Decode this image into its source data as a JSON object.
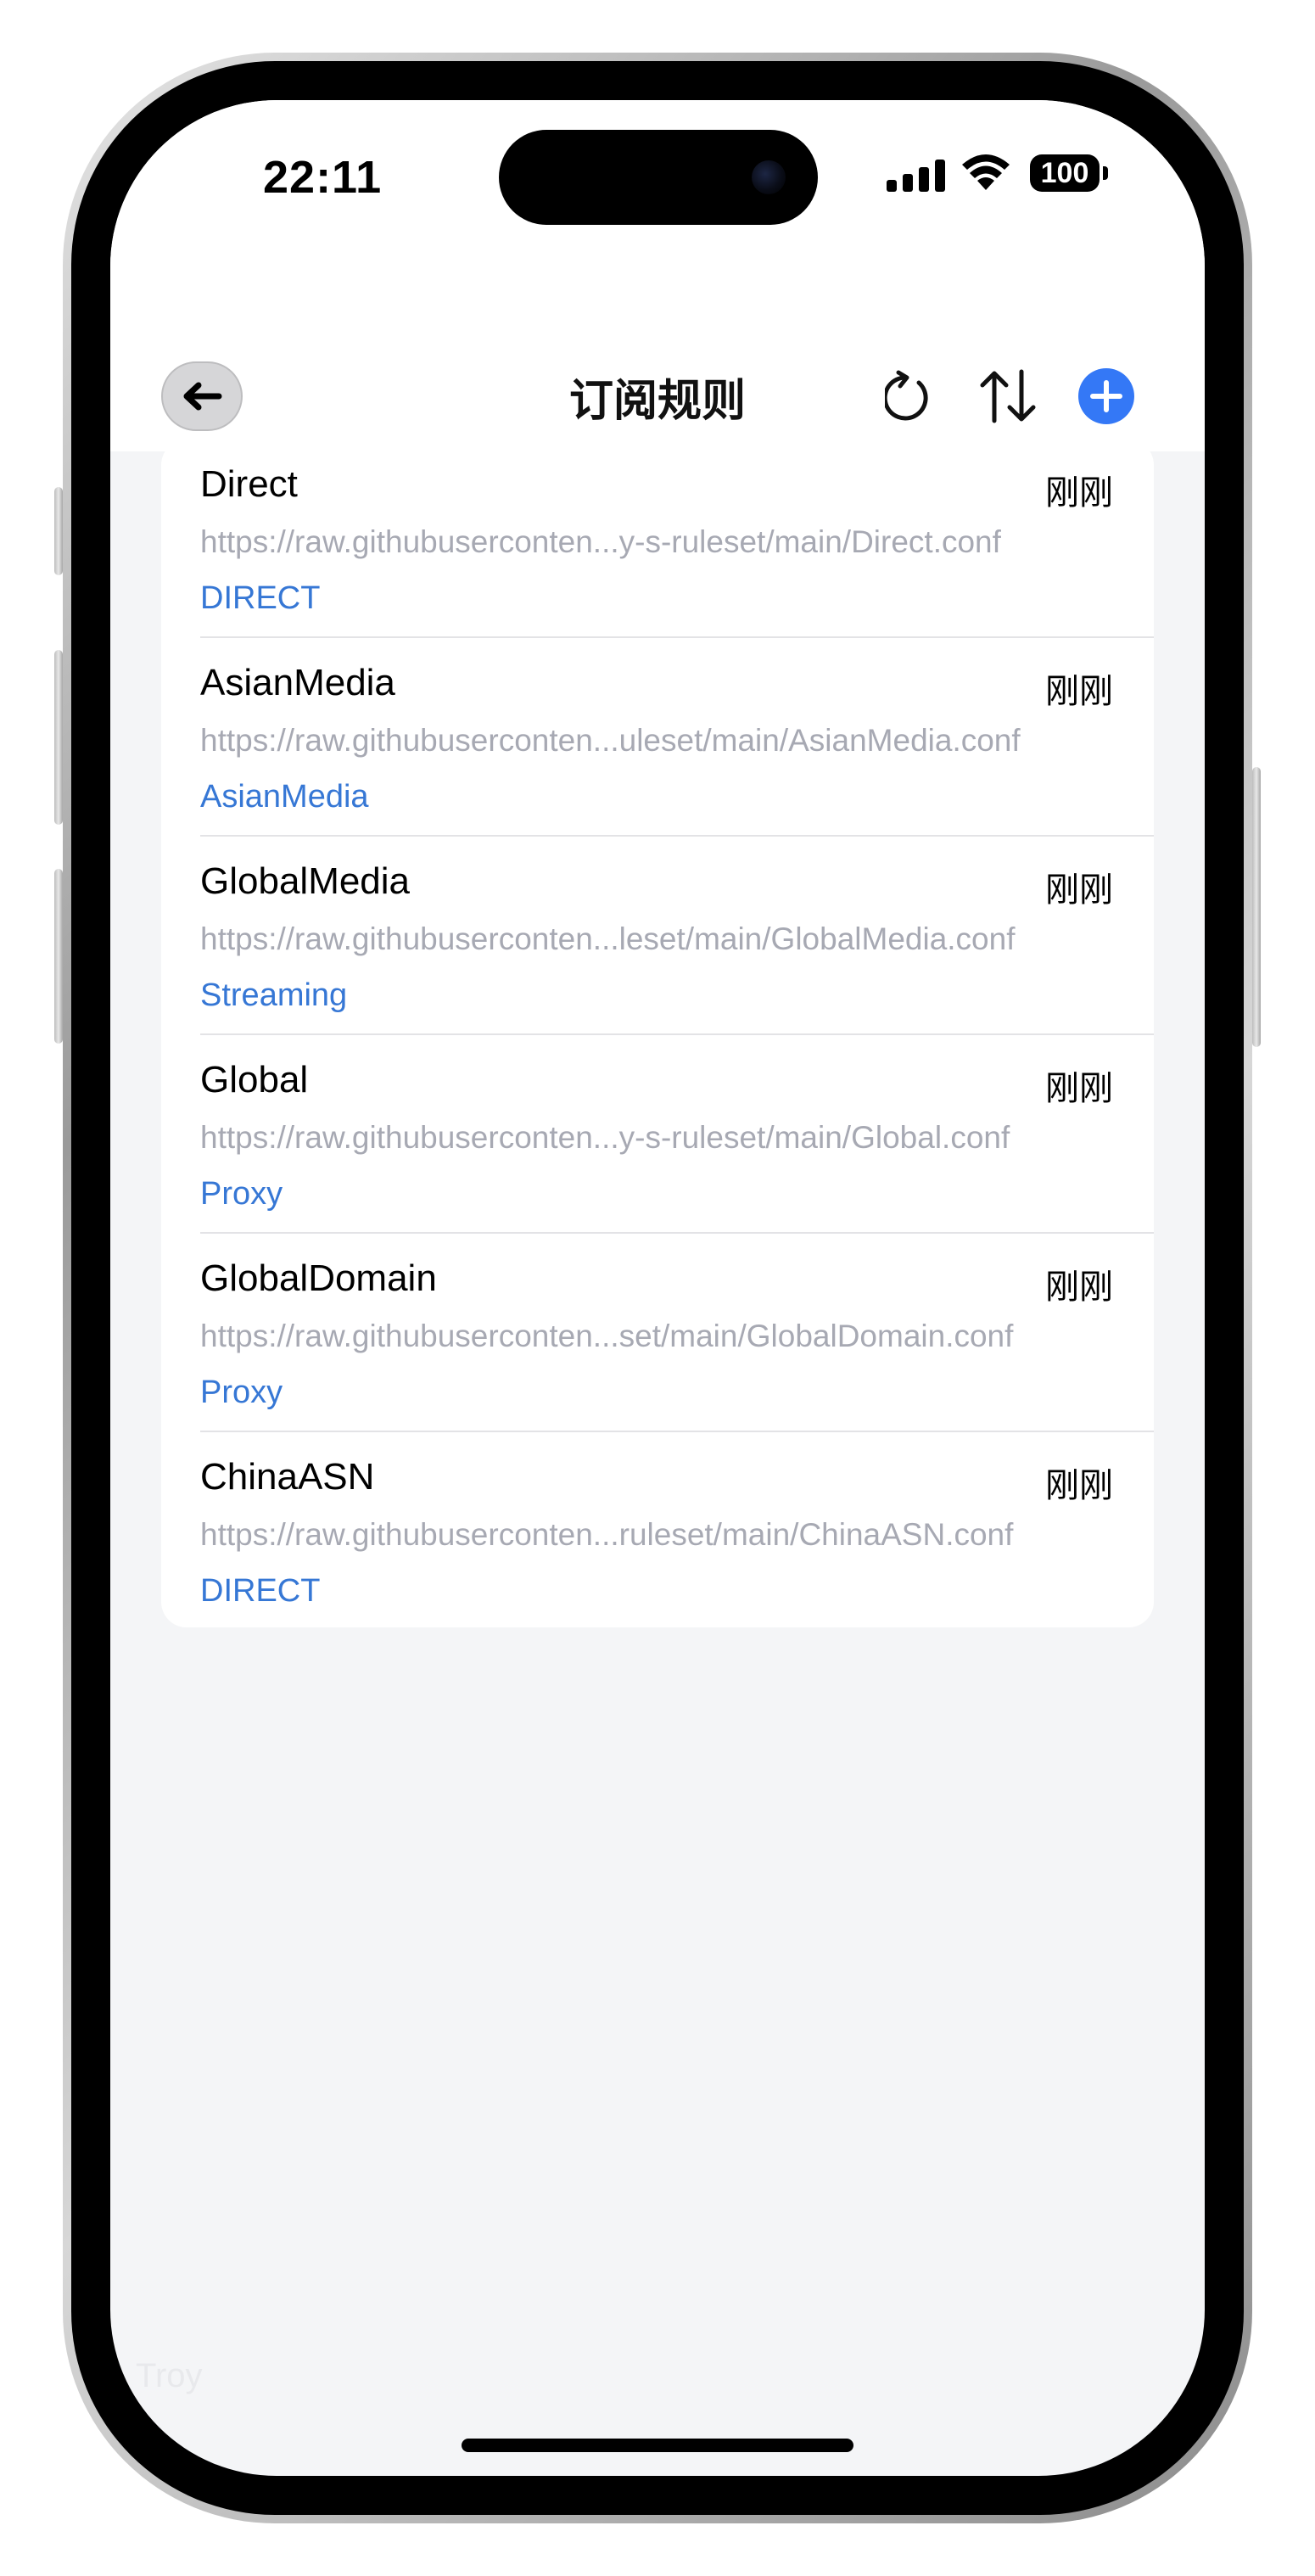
{
  "status_bar": {
    "time": "22:11",
    "battery": "100",
    "icons": [
      "signal-icon",
      "wifi-icon",
      "battery-icon"
    ]
  },
  "nav": {
    "title": "订阅规则",
    "back_icon": "arrow-left-icon",
    "actions": [
      "refresh-icon",
      "sort-icon",
      "add-icon"
    ],
    "accent_color": "#3478f6"
  },
  "rules": [
    {
      "name": "Direct",
      "time": "刚刚",
      "url": "https://raw.githubuserconten...y-s-ruleset/main/Direct.conf",
      "policy": "DIRECT"
    },
    {
      "name": "AsianMedia",
      "time": "刚刚",
      "url": "https://raw.githubuserconten...uleset/main/AsianMedia.conf",
      "policy": "AsianMedia"
    },
    {
      "name": "GlobalMedia",
      "time": "刚刚",
      "url": "https://raw.githubuserconten...leset/main/GlobalMedia.conf",
      "policy": "Streaming"
    },
    {
      "name": "Global",
      "time": "刚刚",
      "url": "https://raw.githubuserconten...y-s-ruleset/main/Global.conf",
      "policy": "Proxy"
    },
    {
      "name": "GlobalDomain",
      "time": "刚刚",
      "url": "https://raw.githubuserconten...set/main/GlobalDomain.conf",
      "policy": "Proxy"
    },
    {
      "name": "ChinaASN",
      "time": "刚刚",
      "url": "https://raw.githubuserconten...ruleset/main/ChinaASN.conf",
      "policy": "DIRECT"
    }
  ],
  "watermark": "Troy",
  "colors": {
    "policy_text": "#3677d5",
    "url_text": "#a7a9b3",
    "background": "#f4f5f7"
  }
}
